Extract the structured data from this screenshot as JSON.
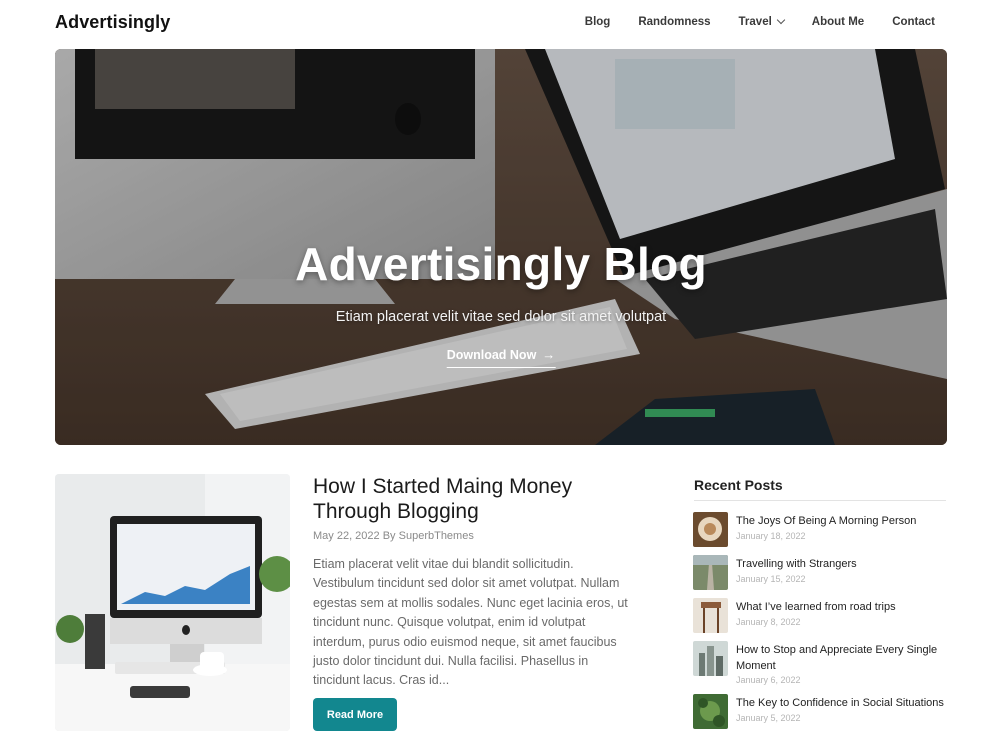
{
  "header": {
    "site_title": "Advertisingly",
    "nav": [
      "Blog",
      "Randomness",
      "Travel",
      "About Me",
      "Contact"
    ]
  },
  "hero": {
    "title": "Advertisingly Blog",
    "subtitle": "Etiam placerat velit vitae sed dolor sit amet volutpat",
    "cta": "Download Now"
  },
  "post": {
    "title": "How I Started Maing Money Through Blogging",
    "date": "May 22, 2022",
    "by": "By",
    "author": "SuperbThemes",
    "excerpt": "Etiam placerat velit vitae dui blandit sollicitudin. Vestibulum tincidunt sed dolor sit amet volutpat. Nullam egestas sem at mollis sodales. Nunc eget lacinia eros, ut tincidunt nunc. Quisque volutpat, enim id volutpat interdum, purus odio euismod neque, sit amet faucibus justo dolor tincidunt dui. Nulla facilisi. Phasellus in tincidunt lacus. Cras id...",
    "read_more": "Read More"
  },
  "sidebar": {
    "recent_posts_title": "Recent Posts",
    "items": [
      {
        "title": "The Joys Of Being A Morning Person",
        "date": "January 18, 2022"
      },
      {
        "title": "Travelling with Strangers",
        "date": "January 15, 2022"
      },
      {
        "title": "What I’ve learned from road trips",
        "date": "January 8, 2022"
      },
      {
        "title": "How to Stop and Appreciate Every Single Moment",
        "date": "January 6, 2022"
      },
      {
        "title": "The Key to Confidence in Social Situations",
        "date": "January 5, 2022"
      }
    ]
  },
  "colors": {
    "accent": "#12878f",
    "text": "#1f1f1f",
    "muted": "#6a6a6a"
  }
}
